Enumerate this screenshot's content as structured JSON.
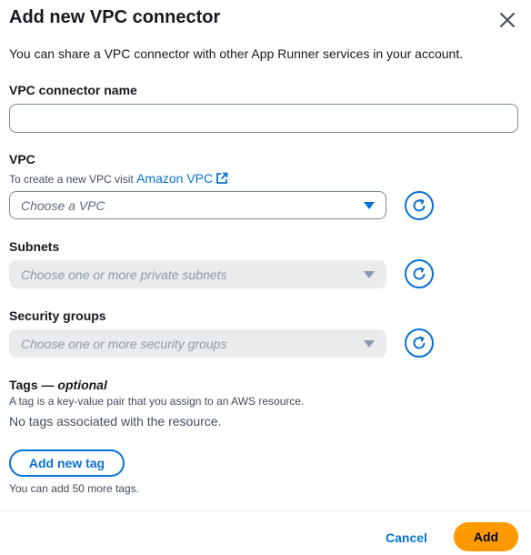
{
  "modal": {
    "title": "Add new VPC connector",
    "description": "You can share a VPC connector with other App Runner services in your account."
  },
  "connector_name": {
    "label": "VPC connector name",
    "value": "",
    "placeholder": ""
  },
  "vpc": {
    "label": "VPC",
    "help_prefix": "To create a new VPC visit",
    "help_link": "Amazon VPC",
    "placeholder": "Choose a VPC",
    "state": "enabled"
  },
  "subnets": {
    "label": "Subnets",
    "placeholder": "Choose one or more private subnets",
    "state": "disabled"
  },
  "security_groups": {
    "label": "Security groups",
    "placeholder": "Choose one or more security groups",
    "state": "disabled"
  },
  "tags": {
    "label": "Tags",
    "optional": "optional",
    "separator": " — ",
    "description": "A tag is a key-value pair that you assign to an AWS resource.",
    "empty_text": "No tags associated with the resource.",
    "add_button": "Add new tag",
    "limit_text": "You can add 50 more tags."
  },
  "footer": {
    "cancel_label": "Cancel",
    "add_label": "Add"
  },
  "icons": {
    "close": "close-icon",
    "external": "external-link-icon",
    "caret": "caret-down-icon",
    "refresh": "refresh-icon"
  },
  "colors": {
    "link": "#0972d3",
    "primary_button": "#ff9900",
    "text": "#16191f",
    "disabled_bg": "#e9ebed"
  }
}
